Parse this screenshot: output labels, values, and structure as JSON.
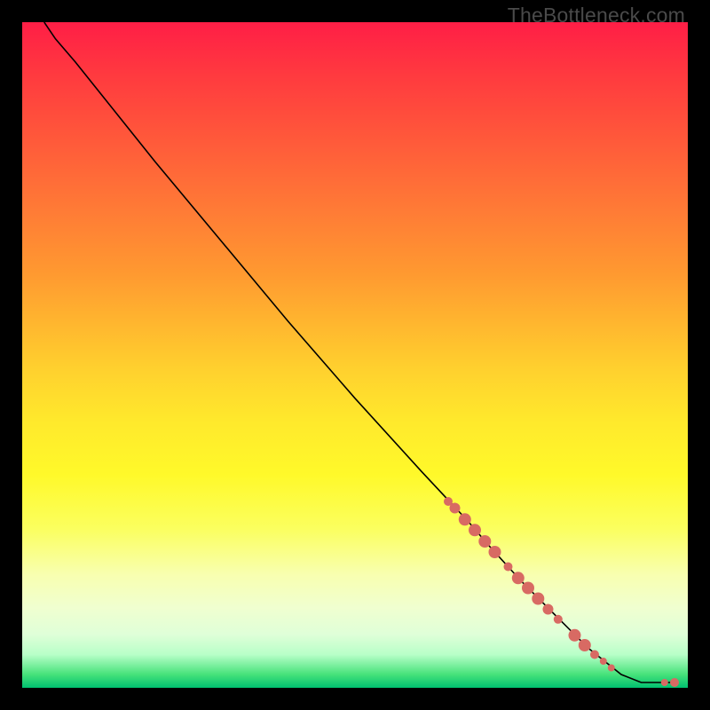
{
  "watermark": "TheBottleneck.com",
  "chart_data": {
    "type": "line",
    "title": "",
    "xlabel": "",
    "ylabel": "",
    "xlim": [
      0,
      100
    ],
    "ylim": [
      0,
      100
    ],
    "curve": [
      {
        "x": 3.3,
        "y": 100.0
      },
      {
        "x": 5.0,
        "y": 97.5
      },
      {
        "x": 8.0,
        "y": 94.0
      },
      {
        "x": 12.0,
        "y": 89.0
      },
      {
        "x": 20.0,
        "y": 79.0
      },
      {
        "x": 30.0,
        "y": 67.0
      },
      {
        "x": 40.0,
        "y": 55.0
      },
      {
        "x": 50.0,
        "y": 43.5
      },
      {
        "x": 60.0,
        "y": 32.5
      },
      {
        "x": 67.0,
        "y": 25.0
      },
      {
        "x": 70.0,
        "y": 21.5
      },
      {
        "x": 75.0,
        "y": 16.0
      },
      {
        "x": 80.0,
        "y": 11.0
      },
      {
        "x": 85.0,
        "y": 6.0
      },
      {
        "x": 90.0,
        "y": 2.0
      },
      {
        "x": 93.0,
        "y": 0.8
      },
      {
        "x": 96.0,
        "y": 0.8
      },
      {
        "x": 98.0,
        "y": 0.8
      }
    ],
    "markers": [
      {
        "x": 64.0,
        "y": 28.0,
        "r": 5
      },
      {
        "x": 65.0,
        "y": 27.0,
        "r": 6
      },
      {
        "x": 66.5,
        "y": 25.3,
        "r": 7
      },
      {
        "x": 68.0,
        "y": 23.7,
        "r": 7
      },
      {
        "x": 69.5,
        "y": 22.0,
        "r": 7
      },
      {
        "x": 71.0,
        "y": 20.4,
        "r": 7
      },
      {
        "x": 73.0,
        "y": 18.2,
        "r": 5
      },
      {
        "x": 74.5,
        "y": 16.5,
        "r": 7
      },
      {
        "x": 76.0,
        "y": 15.0,
        "r": 7
      },
      {
        "x": 77.5,
        "y": 13.4,
        "r": 7
      },
      {
        "x": 79.0,
        "y": 11.8,
        "r": 6
      },
      {
        "x": 80.5,
        "y": 10.3,
        "r": 5
      },
      {
        "x": 83.0,
        "y": 7.9,
        "r": 7
      },
      {
        "x": 84.5,
        "y": 6.4,
        "r": 7
      },
      {
        "x": 86.0,
        "y": 5.0,
        "r": 5
      },
      {
        "x": 87.3,
        "y": 4.0,
        "r": 4
      },
      {
        "x": 88.5,
        "y": 3.0,
        "r": 4
      },
      {
        "x": 96.5,
        "y": 0.8,
        "r": 4
      },
      {
        "x": 98.0,
        "y": 0.8,
        "r": 5
      }
    ],
    "marker_color": "#d86a63",
    "curve_color": "#000000"
  }
}
